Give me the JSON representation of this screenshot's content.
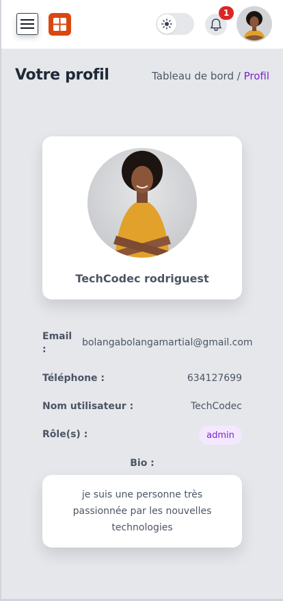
{
  "header": {
    "notification_count": "1",
    "theme_mode": "light",
    "icons": {
      "menu": "hamburger-menu-icon",
      "logo": "grid-logo-icon",
      "theme": "sun-icon",
      "notifications": "bell-icon"
    },
    "colors": {
      "logo": "#d9480f",
      "badge": "#dc2626"
    }
  },
  "page": {
    "title": "Votre profil",
    "breadcrumb": {
      "parent": "Tableau de bord",
      "separator": " / ",
      "current": "Profil"
    }
  },
  "profile": {
    "name": "TechCodec rodriguest",
    "email_label": "Email :",
    "email": "bolangabolangamartial@gmail.com",
    "phone_label": "Téléphone :",
    "phone": "634127699",
    "username_label": "Nom utilisateur :",
    "username": "TechCodec",
    "roles_label": "Rôle(s) :",
    "role": "admin",
    "bio_label": "Bio :",
    "bio": "je suis une personne très passionnée par les nouvelles technologies"
  },
  "accent_color": "#7e22ce"
}
